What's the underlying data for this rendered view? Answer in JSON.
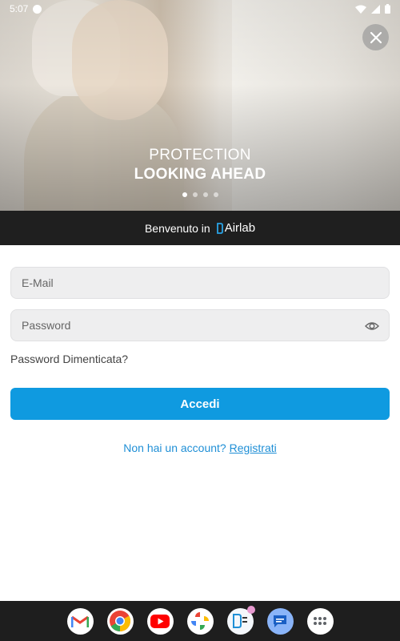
{
  "status_bar": {
    "time": "5:07"
  },
  "hero": {
    "line1": "PROTECTION",
    "line2": "LOOKING AHEAD",
    "slides": [
      true,
      false,
      false,
      false
    ]
  },
  "banner": {
    "welcome": "Benvenuto in",
    "brand": "Airlab"
  },
  "form": {
    "email_placeholder": "E-Mail",
    "password_placeholder": "Password",
    "forgot_label": "Password Dimenticata?",
    "login_label": "Accedi",
    "signup_prompt": "Non hai un account?",
    "signup_link": "Registrati"
  },
  "dock": {
    "apps": [
      "gmail-icon",
      "chrome-icon",
      "youtube-icon",
      "photos-icon",
      "airlab-icon",
      "messages-icon",
      "app-drawer-icon"
    ]
  },
  "colors": {
    "accent": "#0f9ae0",
    "link": "#1f8fd6",
    "banner": "#1f1f1f"
  }
}
